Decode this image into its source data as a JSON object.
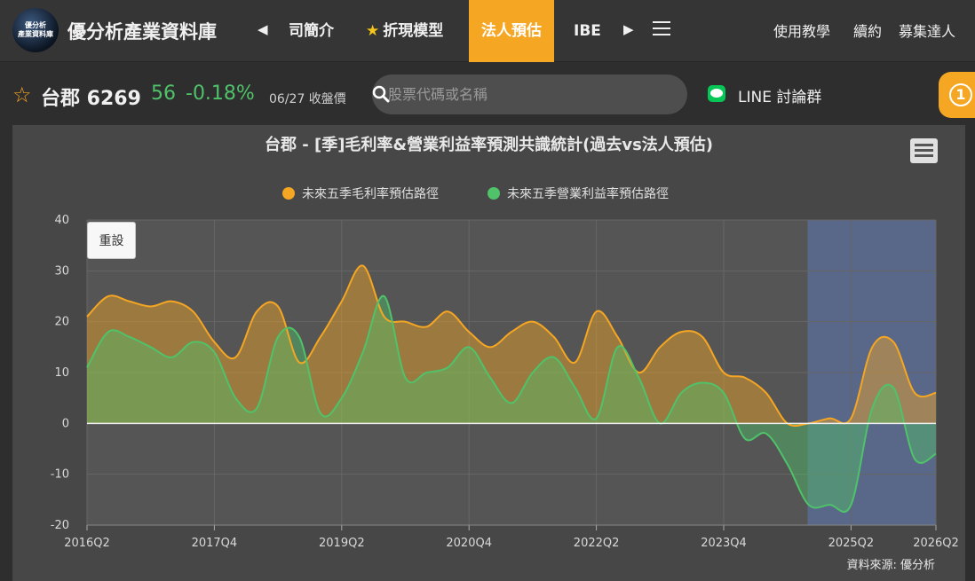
{
  "header": {
    "brand": "優分析產業資料庫",
    "logo_text_1": "優分析",
    "logo_text_2": "產業資料庫",
    "nav_items": [
      {
        "label": "司簡介"
      },
      {
        "label": "折現模型"
      },
      {
        "label": "法人預估"
      },
      {
        "label": "IBE"
      }
    ],
    "right_links": [
      "使用教學",
      "續約",
      "募集達人"
    ]
  },
  "quote": {
    "name": "台郡 6269",
    "price": "56",
    "change": "-0.18%",
    "date": "06/27 收盤價"
  },
  "search": {
    "placeholder": "股票代碼或名稱"
  },
  "line_group": "LINE 討論群",
  "notify_count": "1",
  "chart_reset": "重設",
  "chart_source": "資料來源: 優分析",
  "colors": {
    "gross": "#f5a623",
    "operating": "#4fc26a",
    "forecast_band": "#5b6e99"
  },
  "chart_data": {
    "type": "area",
    "title": "台郡 - [季]毛利率&營業利益率預測共識統計(過去vs法人預估)",
    "x_tick_labels": [
      "2016Q2",
      "2017Q4",
      "2019Q2",
      "2020Q4",
      "2022Q2",
      "2023Q4",
      "2025Q2",
      "2026Q2"
    ],
    "x": [
      "2016Q2",
      "2016Q3",
      "2016Q4",
      "2017Q1",
      "2017Q2",
      "2017Q3",
      "2017Q4",
      "2018Q1",
      "2018Q2",
      "2018Q3",
      "2018Q4",
      "2019Q1",
      "2019Q2",
      "2019Q3",
      "2019Q4",
      "2020Q1",
      "2020Q2",
      "2020Q3",
      "2020Q4",
      "2021Q1",
      "2021Q2",
      "2021Q3",
      "2021Q4",
      "2022Q1",
      "2022Q2",
      "2022Q3",
      "2022Q4",
      "2023Q1",
      "2023Q2",
      "2023Q3",
      "2023Q4",
      "2024Q1",
      "2024Q2",
      "2024Q3",
      "2024Q4",
      "2025Q1",
      "2025Q2",
      "2025Q3",
      "2025Q4",
      "2026Q1",
      "2026Q2"
    ],
    "ylim": [
      -20,
      40
    ],
    "y_ticks": [
      -20,
      -10,
      0,
      10,
      20,
      30,
      40
    ],
    "legend_position": "top",
    "grid": true,
    "forecast_start": "2025Q1",
    "series": [
      {
        "name": "未來五季毛利率預估路徑",
        "values": [
          21,
          25,
          24,
          23,
          24,
          22,
          16,
          13,
          22,
          23,
          12,
          17,
          24,
          31,
          21,
          20,
          19,
          22,
          18,
          15,
          18,
          20,
          17,
          12,
          22,
          17,
          10,
          15,
          18,
          17,
          10,
          9,
          6,
          0,
          0,
          1,
          1,
          15,
          16,
          6,
          6
        ]
      },
      {
        "name": "未來五季營業利益率預估路徑",
        "values": [
          11,
          18,
          17,
          15,
          13,
          16,
          14,
          5,
          3,
          17,
          17,
          2,
          5,
          14,
          25,
          9,
          10,
          11,
          15,
          9,
          4,
          10,
          13,
          7,
          1,
          15,
          9,
          0,
          6,
          8,
          6,
          -3,
          -2,
          -8,
          -16,
          -16,
          -16,
          3,
          7,
          -7,
          -6
        ]
      }
    ]
  }
}
